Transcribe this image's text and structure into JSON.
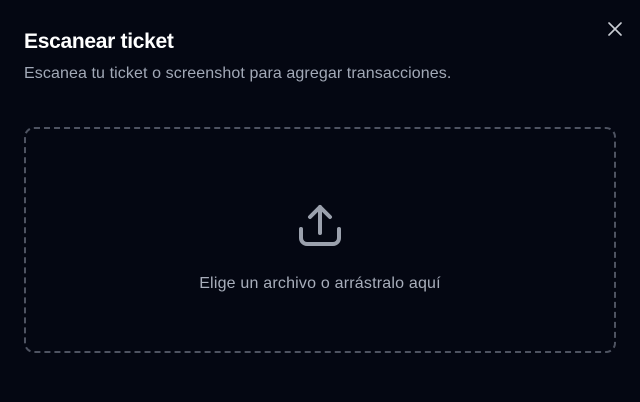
{
  "dialog": {
    "title": "Escanear ticket",
    "subtitle": "Escanea tu ticket o screenshot para agregar transacciones.",
    "close_icon": "close-icon"
  },
  "dropzone": {
    "icon": "upload-icon",
    "label": "Elige un archivo o arrástralo aquí"
  },
  "colors": {
    "background": "#040712",
    "title": "#ffffff",
    "subtitle": "#a2a9b7",
    "dropzone_border": "#4e5361",
    "icon": "#9ba1ad"
  }
}
